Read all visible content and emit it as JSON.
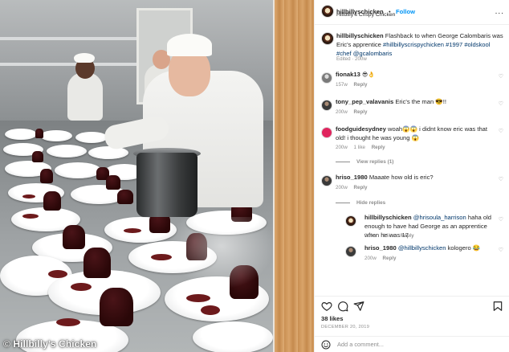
{
  "photo": {
    "watermark": "© Hillbilly's Chicken"
  },
  "header": {
    "username": "hillbillyschicken",
    "separator": "•",
    "follow_label": "Follow",
    "subtitle": "Hillbilly's Crispy Chicken",
    "more_label": "..."
  },
  "caption": {
    "username": "hillbillyschicken",
    "text": "Flashback to when George Calombaris was Eric's apprentice",
    "hashtags": "#hillbillyscrispychicken #1997 #oldskool #chef",
    "mention": "@gcalombaris",
    "meta": "Edited · 200w"
  },
  "comments": [
    {
      "username": "fionak13",
      "text": "😎👌",
      "time": "157w",
      "reply_label": "Reply",
      "likes": ""
    },
    {
      "username": "tony_pep_valavanis",
      "text": "Eric's the man 😎!!",
      "time": "200w",
      "reply_label": "Reply",
      "likes": ""
    },
    {
      "username": "foodguidesydney",
      "text": "woah😱😱 i didnt know eric was that old! i thought he was young 😱",
      "time": "200w",
      "reply_label": "Reply",
      "likes": "1 like"
    },
    {
      "view_replies": "View replies (1)"
    },
    {
      "username": "hriso_1980",
      "text": "Maaate how old is eric?",
      "time": "200w",
      "reply_label": "Reply",
      "likes": ""
    },
    {
      "hide_replies": "Hide replies"
    },
    {
      "username": "hillbillyschicken",
      "mention": "@hrisoula_harrison",
      "text": "haha old enough to have had George as an apprentice when he was 17",
      "time": "200w",
      "reply_label": "Reply",
      "likes": "1 like"
    },
    {
      "username": "hriso_1980",
      "mention": "@hillbillyschicken",
      "text": "kologero 😂",
      "time": "200w",
      "reply_label": "Reply",
      "likes": ""
    }
  ],
  "footer": {
    "likes": "38 likes",
    "date": "DECEMBER 20, 2019",
    "add_comment_placeholder": "Add a comment..."
  },
  "icons": {
    "heart": "heart-icon",
    "comment": "comment-icon",
    "share": "share-icon",
    "bookmark": "bookmark-icon",
    "emoji": "emoji-icon"
  },
  "colors": {
    "link": "#00376b",
    "follow": "#0095f6",
    "muted": "#8e8e8e"
  }
}
